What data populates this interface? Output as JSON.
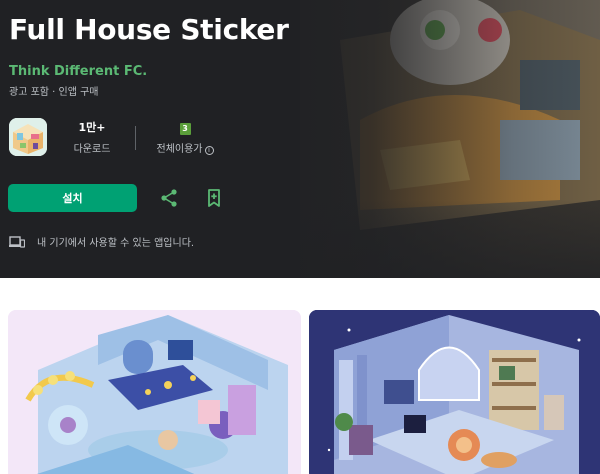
{
  "app": {
    "title": "Full House Sticker",
    "developer": "Think Different FC.",
    "ads_note": "광고 포함 · 인앱 구매"
  },
  "stats": {
    "downloads_value": "1만+",
    "downloads_label": "다운로드",
    "rating_badge": "3",
    "rating_label": "전체이용가"
  },
  "actions": {
    "install_label": "설치"
  },
  "device": {
    "text": "내 기기에서 사용할 수 있는 앱입니다."
  },
  "icons": {
    "share": "share-icon",
    "wishlist": "bookmark-add-icon",
    "device": "devices-icon",
    "info": "info-icon"
  },
  "colors": {
    "background_dark": "#202124",
    "accent": "#00a173",
    "developer": "#5bb974"
  }
}
